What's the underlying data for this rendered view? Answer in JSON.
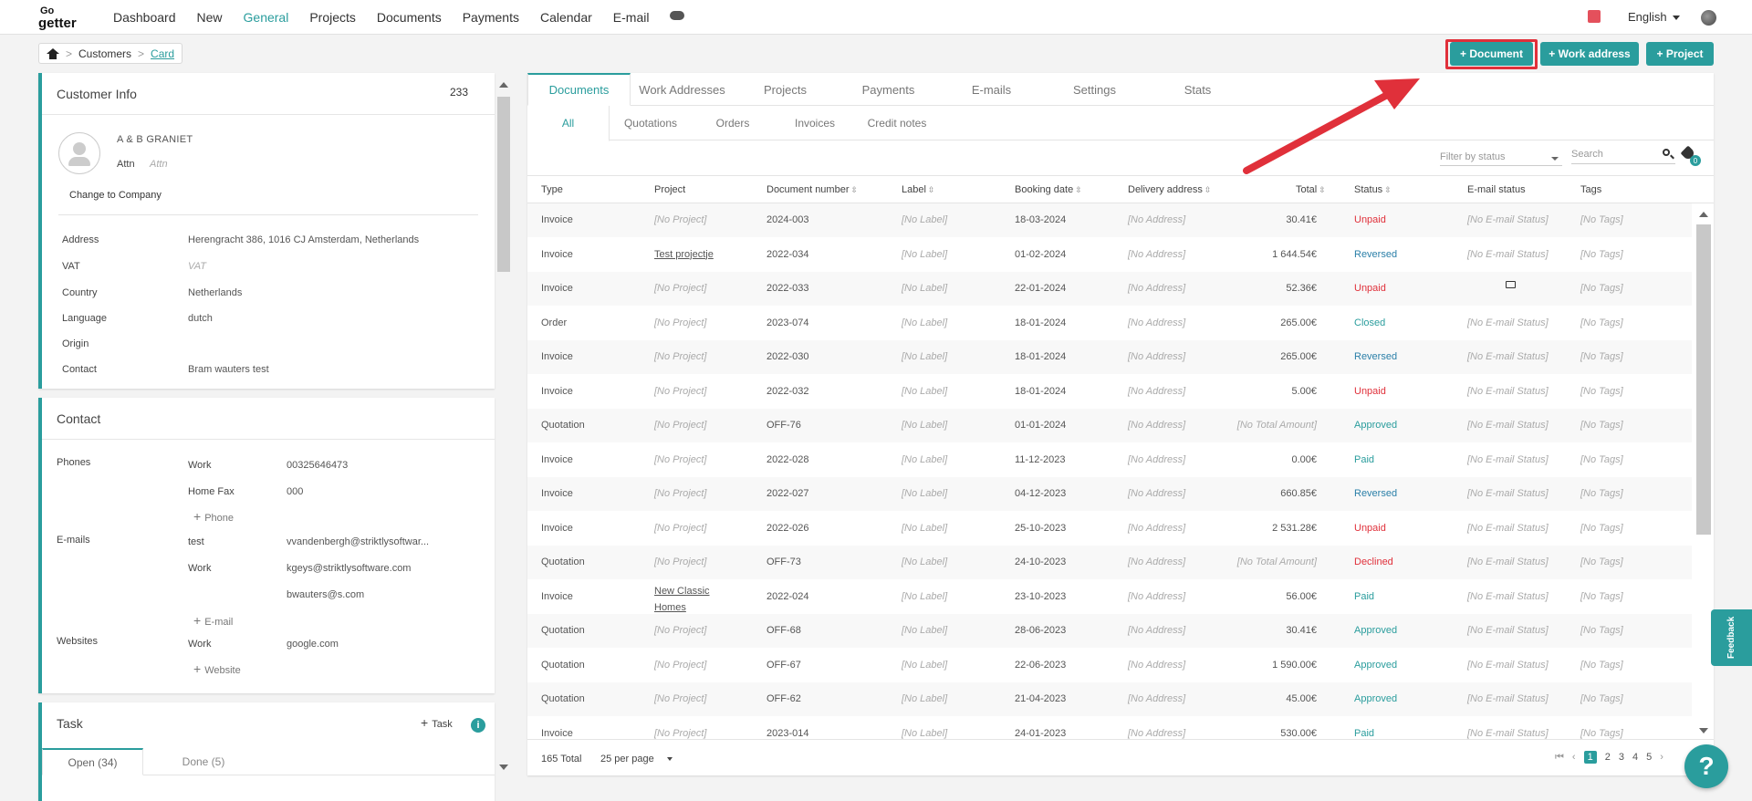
{
  "brand": {
    "logo_top": "Go",
    "logo_bottom": "getter"
  },
  "nav": [
    "Dashboard",
    "New",
    "General",
    "Projects",
    "Documents",
    "Payments",
    "Calendar",
    "E-mail"
  ],
  "language": "English",
  "breadcrumb": {
    "customers": "Customers",
    "card": "Card"
  },
  "actions": {
    "document": "+ Document",
    "work_address": "+ Work address",
    "project": "+ Project"
  },
  "customer_info": {
    "title": "Customer Info",
    "count": "233",
    "name": "A & B GRANIET",
    "attn_label": "Attn",
    "attn_placeholder": "Attn",
    "change_company": "Change to Company",
    "rows": [
      {
        "label": "Address",
        "value": "Herengracht 386, 1016 CJ Amsterdam, Netherlands"
      },
      {
        "label": "VAT",
        "value": "VAT"
      },
      {
        "label": "Country",
        "value": "Netherlands"
      },
      {
        "label": "Language",
        "value": "dutch"
      },
      {
        "label": "Origin",
        "value": ""
      },
      {
        "label": "Contact",
        "value": "Bram wauters test"
      }
    ]
  },
  "contact": {
    "title": "Contact",
    "phones_label": "Phones",
    "phones": [
      {
        "type": "Work",
        "value": "00325646473"
      },
      {
        "type": "Home Fax",
        "value": "000"
      }
    ],
    "add_phone": "Phone",
    "emails_label": "E-mails",
    "emails": [
      {
        "type": "test",
        "value": "vvandenbergh@striktlysoftwar..."
      },
      {
        "type": "Work",
        "value": "kgeys@striktlysoftware.com"
      },
      {
        "type": "",
        "value": "bwauters@s.com"
      }
    ],
    "add_email": "E-mail",
    "websites_label": "Websites",
    "websites": [
      {
        "type": "Work",
        "value": "google.com"
      }
    ],
    "add_website": "Website"
  },
  "task": {
    "title": "Task",
    "add": "Task",
    "tabs": [
      "Open (34)",
      "Done (5)"
    ]
  },
  "tabs": [
    "Documents",
    "Work Addresses",
    "Projects",
    "Payments",
    "E-mails",
    "Settings",
    "Stats"
  ],
  "subtabs": [
    "All",
    "Quotations",
    "Orders",
    "Invoices",
    "Credit notes"
  ],
  "filter_placeholder": "Filter by status",
  "search_placeholder": "Search",
  "tag_count": "0",
  "columns": [
    "Type",
    "Project",
    "Document number",
    "Label",
    "Booking date",
    "Delivery address",
    "Total",
    "Status",
    "E-mail status",
    "Tags"
  ],
  "rows": [
    {
      "type": "Invoice",
      "project": "[No Project]",
      "doc": "2024-003",
      "label": "[No Label]",
      "date": "18-03-2024",
      "address": "[No Address]",
      "total": "30.41€",
      "status": "Unpaid",
      "email": "[No E-mail Status]",
      "tags": "[No Tags]"
    },
    {
      "type": "Invoice",
      "project": "Test projectje",
      "doc": "2022-034",
      "label": "[No Label]",
      "date": "01-02-2024",
      "address": "[No Address]",
      "total": "1 644.54€",
      "status": "Reversed",
      "email": "[No E-mail Status]",
      "tags": "[No Tags]"
    },
    {
      "type": "Invoice",
      "project": "[No Project]",
      "doc": "2022-033",
      "label": "[No Label]",
      "date": "22-01-2024",
      "address": "[No Address]",
      "total": "52.36€",
      "status": "Unpaid",
      "email": "",
      "tags": "[No Tags]"
    },
    {
      "type": "Order",
      "project": "[No Project]",
      "doc": "2023-074",
      "label": "[No Label]",
      "date": "18-01-2024",
      "address": "[No Address]",
      "total": "265.00€",
      "status": "Closed",
      "email": "[No E-mail Status]",
      "tags": "[No Tags]"
    },
    {
      "type": "Invoice",
      "project": "[No Project]",
      "doc": "2022-030",
      "label": "[No Label]",
      "date": "18-01-2024",
      "address": "[No Address]",
      "total": "265.00€",
      "status": "Reversed",
      "email": "[No E-mail Status]",
      "tags": "[No Tags]"
    },
    {
      "type": "Invoice",
      "project": "[No Project]",
      "doc": "2022-032",
      "label": "[No Label]",
      "date": "18-01-2024",
      "address": "[No Address]",
      "total": "5.00€",
      "status": "Unpaid",
      "email": "[No E-mail Status]",
      "tags": "[No Tags]"
    },
    {
      "type": "Quotation",
      "project": "[No Project]",
      "doc": "OFF-76",
      "label": "[No Label]",
      "date": "01-01-2024",
      "address": "[No Address]",
      "total": "[No Total Amount]",
      "status": "Approved",
      "email": "[No E-mail Status]",
      "tags": "[No Tags]"
    },
    {
      "type": "Invoice",
      "project": "[No Project]",
      "doc": "2022-028",
      "label": "[No Label]",
      "date": "11-12-2023",
      "address": "[No Address]",
      "total": "0.00€",
      "status": "Paid",
      "email": "[No E-mail Status]",
      "tags": "[No Tags]"
    },
    {
      "type": "Invoice",
      "project": "[No Project]",
      "doc": "2022-027",
      "label": "[No Label]",
      "date": "04-12-2023",
      "address": "[No Address]",
      "total": "660.85€",
      "status": "Reversed",
      "email": "[No E-mail Status]",
      "tags": "[No Tags]"
    },
    {
      "type": "Invoice",
      "project": "[No Project]",
      "doc": "2022-026",
      "label": "[No Label]",
      "date": "25-10-2023",
      "address": "[No Address]",
      "total": "2 531.28€",
      "status": "Unpaid",
      "email": "[No E-mail Status]",
      "tags": "[No Tags]"
    },
    {
      "type": "Quotation",
      "project": "[No Project]",
      "doc": "OFF-73",
      "label": "[No Label]",
      "date": "24-10-2023",
      "address": "[No Address]",
      "total": "[No Total Amount]",
      "status": "Declined",
      "email": "[No E-mail Status]",
      "tags": "[No Tags]"
    },
    {
      "type": "Invoice",
      "project": "New Classic Homes",
      "doc": "2022-024",
      "label": "[No Label]",
      "date": "23-10-2023",
      "address": "[No Address]",
      "total": "56.00€",
      "status": "Paid",
      "email": "[No E-mail Status]",
      "tags": "[No Tags]"
    },
    {
      "type": "Quotation",
      "project": "[No Project]",
      "doc": "OFF-68",
      "label": "[No Label]",
      "date": "28-06-2023",
      "address": "[No Address]",
      "total": "30.41€",
      "status": "Approved",
      "email": "[No E-mail Status]",
      "tags": "[No Tags]"
    },
    {
      "type": "Quotation",
      "project": "[No Project]",
      "doc": "OFF-67",
      "label": "[No Label]",
      "date": "22-06-2023",
      "address": "[No Address]",
      "total": "1 590.00€",
      "status": "Approved",
      "email": "[No E-mail Status]",
      "tags": "[No Tags]"
    },
    {
      "type": "Quotation",
      "project": "[No Project]",
      "doc": "OFF-62",
      "label": "[No Label]",
      "date": "21-04-2023",
      "address": "[No Address]",
      "total": "45.00€",
      "status": "Approved",
      "email": "[No E-mail Status]",
      "tags": "[No Tags]"
    },
    {
      "type": "Invoice",
      "project": "[No Project]",
      "doc": "2023-014",
      "label": "[No Label]",
      "date": "24-01-2023",
      "address": "[No Address]",
      "total": "530.00€",
      "status": "Paid",
      "email": "[No E-mail Status]",
      "tags": "[No Tags]"
    }
  ],
  "footer": {
    "total": "165 Total",
    "per_page": "25 per page",
    "pages": [
      "1",
      "2",
      "3",
      "4",
      "5"
    ]
  },
  "feedback": "Feedback",
  "help": "?",
  "colors": {
    "accent": "#2a9d9d",
    "danger": "#e0303a",
    "reversed": "#2a7fa8",
    "annotation": "#e0303a"
  }
}
